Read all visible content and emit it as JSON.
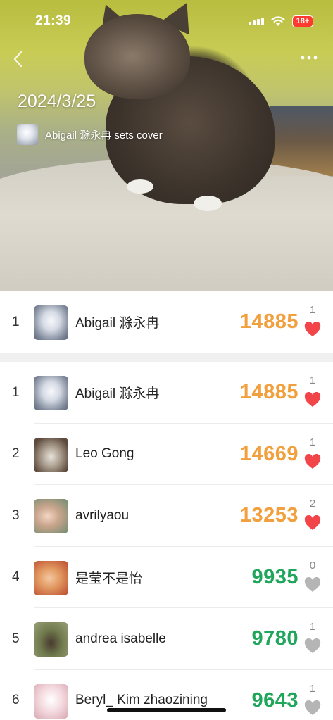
{
  "status_bar": {
    "time": "21:39",
    "battery": "18+"
  },
  "cover": {
    "date": "2024/3/25",
    "setter_text": "Abigail 滁永冉 sets cover"
  },
  "my_rank": {
    "rank": "1",
    "name": "Abigail 滁永冉",
    "score": "14885",
    "likes": "1",
    "liked": true,
    "avatar": "seal"
  },
  "ranking": [
    {
      "rank": "1",
      "name": "Abigail 滁永冉",
      "score": "14885",
      "likes": "1",
      "liked": true,
      "avatar": "seal"
    },
    {
      "rank": "2",
      "name": "Leo Gong",
      "score": "14669",
      "likes": "1",
      "liked": true,
      "avatar": "cat"
    },
    {
      "rank": "3",
      "name": "avrilyaou",
      "score": "13253",
      "likes": "2",
      "liked": true,
      "avatar": "baby"
    },
    {
      "rank": "4",
      "name": "是莹不是怡",
      "score": "9935",
      "likes": "0",
      "liked": false,
      "avatar": "girl"
    },
    {
      "rank": "5",
      "name": "andrea isabelle",
      "score": "9780",
      "likes": "1",
      "liked": false,
      "avatar": "andrea"
    },
    {
      "rank": "6",
      "name": "Beryl_ Kim zhaozining",
      "score": "9643",
      "likes": "1",
      "liked": false,
      "avatar": "beryl"
    }
  ],
  "colors": {
    "score_high": "#f2a03d",
    "score_normal": "#1fa65a",
    "heart_liked": "#f2454a",
    "heart_unliked": "#b5b5b5"
  }
}
